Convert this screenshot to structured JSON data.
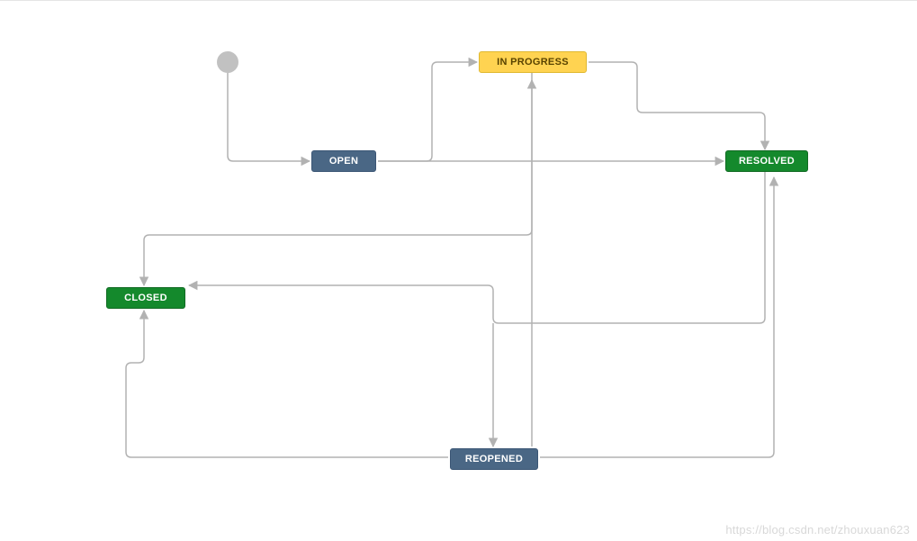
{
  "diagram": {
    "type": "workflow-state-diagram",
    "nodes": {
      "start": {
        "kind": "start"
      },
      "open": {
        "label": "OPEN",
        "color": "#4a6785"
      },
      "inprogress": {
        "label": "IN PROGRESS",
        "color": "#ffd351"
      },
      "resolved": {
        "label": "RESOLVED",
        "color": "#14892c"
      },
      "closed": {
        "label": "CLOSED",
        "color": "#14892c"
      },
      "reopened": {
        "label": "REOPENED",
        "color": "#4a6785"
      }
    },
    "edges": [
      {
        "from": "start",
        "to": "open"
      },
      {
        "from": "open",
        "to": "inprogress"
      },
      {
        "from": "open",
        "to": "resolved"
      },
      {
        "from": "inprogress",
        "to": "resolved"
      },
      {
        "from": "inprogress",
        "to": "closed"
      },
      {
        "from": "resolved",
        "to": "closed"
      },
      {
        "from": "resolved",
        "to": "reopened"
      },
      {
        "from": "reopened",
        "to": "inprogress"
      },
      {
        "from": "reopened",
        "to": "resolved"
      },
      {
        "from": "reopened",
        "to": "closed"
      }
    ]
  },
  "watermark": "https://blog.csdn.net/zhouxuan623"
}
